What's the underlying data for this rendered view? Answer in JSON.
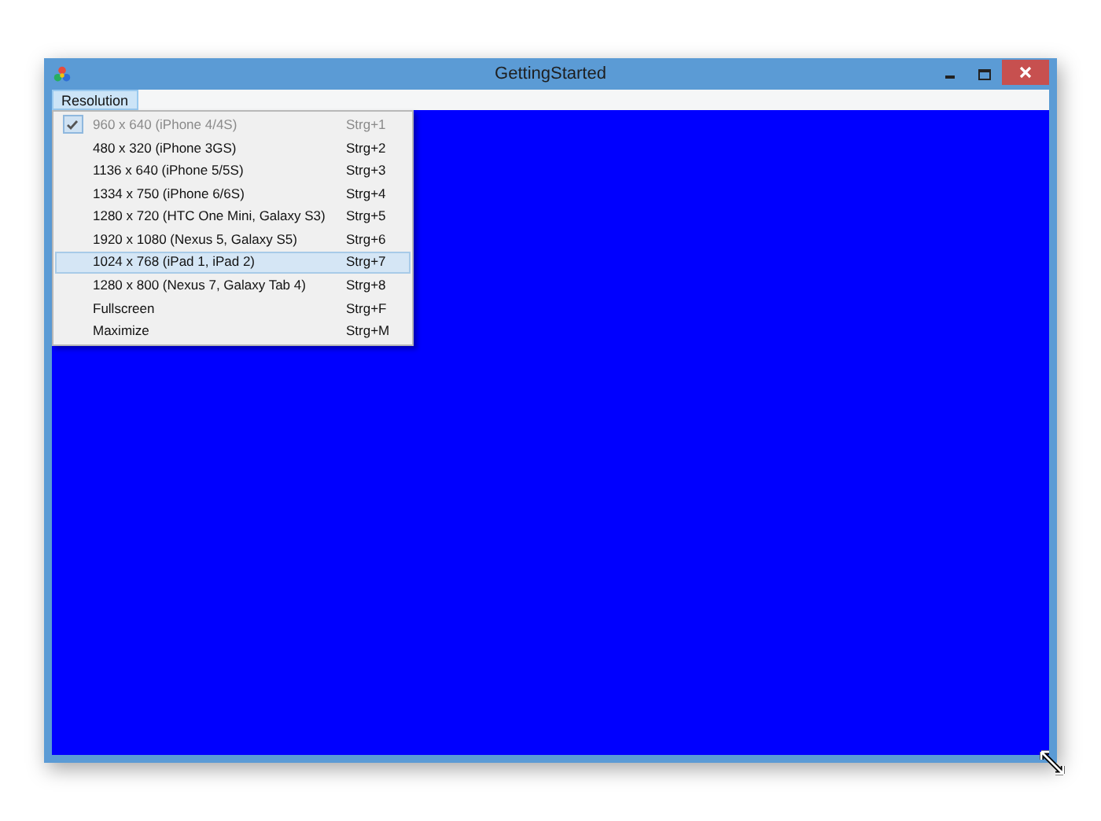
{
  "window": {
    "title": "GettingStarted"
  },
  "menu_bar": [
    {
      "label": "Resolution",
      "selected": true
    }
  ],
  "menu": [
    {
      "label": "960 x 640 (iPhone 4/4S)",
      "shortcut": "Strg+1",
      "checked": true,
      "disabled": true,
      "selected": false
    },
    {
      "label": "480 x 320 (iPhone 3GS)",
      "shortcut": "Strg+2",
      "checked": false,
      "disabled": false,
      "selected": false
    },
    {
      "label": "1136 x 640 (iPhone 5/5S)",
      "shortcut": "Strg+3",
      "checked": false,
      "disabled": false,
      "selected": false
    },
    {
      "label": "1334 x 750 (iPhone 6/6S)",
      "shortcut": "Strg+4",
      "checked": false,
      "disabled": false,
      "selected": false
    },
    {
      "label": "1280 x 720 (HTC One Mini, Galaxy S3)",
      "shortcut": "Strg+5",
      "checked": false,
      "disabled": false,
      "selected": false
    },
    {
      "label": "1920 x 1080 (Nexus 5, Galaxy S5)",
      "shortcut": "Strg+6",
      "checked": false,
      "disabled": false,
      "selected": false
    },
    {
      "label": "1024 x 768 (iPad 1, iPad 2)",
      "shortcut": "Strg+7",
      "checked": false,
      "disabled": false,
      "selected": true
    },
    {
      "label": "1280 x 800 (Nexus 7, Galaxy Tab 4)",
      "shortcut": "Strg+8",
      "checked": false,
      "disabled": false,
      "selected": false
    },
    {
      "label": "Fullscreen",
      "shortcut": "Strg+F",
      "checked": false,
      "disabled": false,
      "selected": false
    },
    {
      "label": "Maximize",
      "shortcut": "Strg+M",
      "checked": false,
      "disabled": false,
      "selected": false
    }
  ]
}
